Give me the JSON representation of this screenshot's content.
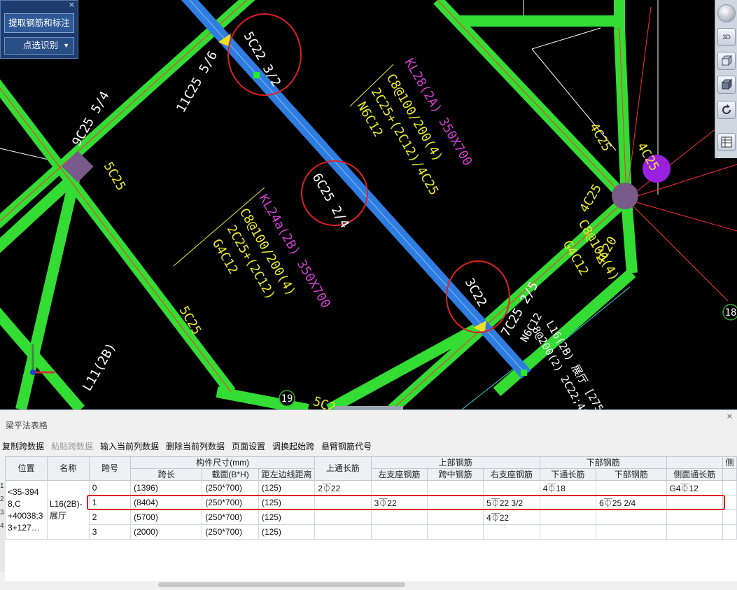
{
  "floating_panel": {
    "close_glyph": "×",
    "extract_button": "提取钢筋和标注",
    "identify_button": "点选识别",
    "identify_arrow": "▼"
  },
  "view_toolbar": {
    "button_3d": "3D"
  },
  "drawing": {
    "annotations_white": [
      "5C22 3/2",
      "11C25 5/6",
      "9C25 5/4",
      "6C25 2/4",
      "3C22",
      "7C25 2/5",
      "L11(2B)",
      "L16(2B) 展厅 [27516] 250*7",
      "N6C12",
      "8@200(2) 2C22;4C18"
    ],
    "annotations_yellow": [
      "5C25",
      "5C25",
      "4C25",
      "4C25",
      "4C25",
      "4C20",
      "C8@100(4)",
      "G4C12",
      "C8@100/200(4)",
      "2C25+(2C12)",
      "G4C12",
      "C8@100/200(4)",
      "2C25+(2C12)/4C25",
      "N6C12",
      "5C2"
    ],
    "annotations_magenta": [
      "KL28(2A) 350X700",
      "KL24a(2B) 350X700"
    ],
    "axis_labels": [
      "19",
      "18"
    ],
    "colors": {
      "background": "#000000",
      "beam_green": "#33dd33",
      "selected_beam_blue": "#2f7de0",
      "callout_red": "#e02020",
      "text_yellow": "#e8e830",
      "text_magenta": "#d040d0",
      "column_purple": "#7a5a8a"
    }
  },
  "table_panel": {
    "title": "梁平法表格",
    "close_glyph": "×",
    "toolbar": [
      "复制跨数据",
      "粘贴跨数据",
      "输入当前列数据",
      "删除当前列数据",
      "页面设置",
      "调换起始跨",
      "悬臂钢筋代号"
    ],
    "toolbar_disabled": [
      false,
      true,
      false,
      false,
      false,
      false,
      false
    ],
    "row_numbers": [
      "1",
      "2",
      "3",
      "4"
    ],
    "headers": {
      "position": "位置",
      "name": "名称",
      "span_no": "跨号",
      "dimensions_group": "构件尺寸(mm)",
      "span_length": "跨长",
      "section": "截面(B*H)",
      "edge_distance": "距左边线距离",
      "top_through": "上通长筋",
      "top_group": "上部钢筋",
      "left_support": "左支座钢筋",
      "mid_span": "跨中钢筋",
      "right_support": "右支座钢筋",
      "bottom_group": "下部钢筋",
      "bottom_through": "下通长筋",
      "bottom_rebar": "下部钢筋",
      "side_through": "侧面通长筋",
      "side_partial": "侧"
    },
    "position_value": "<35-394 8,C +40038;3 3+127…",
    "name_value": "L16(2B)-展厅",
    "rows": [
      {
        "span": "0",
        "length": "(1396)",
        "section": "(250*700)",
        "edge": "(125)",
        "top_through": "2⏁22",
        "left_support": "",
        "mid_span": "",
        "right_support": "",
        "bottom_through": "4⏁18",
        "bottom_rebar": "",
        "side_through": "G4⏁12"
      },
      {
        "span": "1",
        "length": "(8404)",
        "section": "(250*700)",
        "edge": "(125)",
        "top_through": "",
        "left_support": "3⏁22",
        "mid_span": "",
        "right_support": "5⏁22 3/2",
        "bottom_through": "",
        "bottom_rebar": "6⏁25 2/4",
        "side_through": ""
      },
      {
        "span": "2",
        "length": "(5700)",
        "section": "(250*700)",
        "edge": "(125)",
        "top_through": "",
        "left_support": "",
        "mid_span": "",
        "right_support": "4⏁22",
        "bottom_through": "",
        "bottom_rebar": "",
        "side_through": ""
      },
      {
        "span": "3",
        "length": "(2000)",
        "section": "(250*700)",
        "edge": "(125)",
        "top_through": "",
        "left_support": "",
        "mid_span": "",
        "right_support": "",
        "bottom_through": "",
        "bottom_rebar": "",
        "side_through": ""
      }
    ]
  }
}
